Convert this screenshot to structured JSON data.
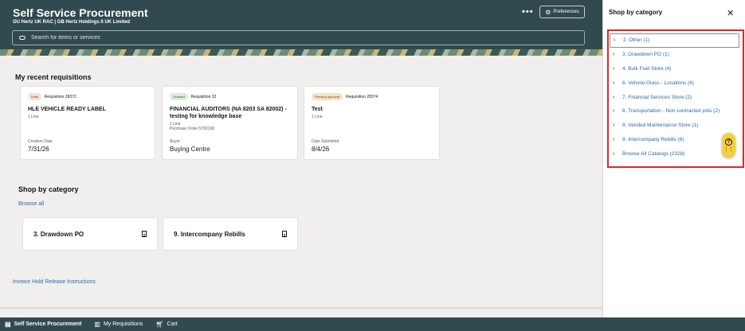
{
  "header": {
    "title": "Self Service Procurement",
    "subtitle": "OU Hertz UK RAC | GB Hertz Holdings II UK Limited",
    "more_label": "•••",
    "preferences_label": "Preferences",
    "search_placeholder": "Search for items or services"
  },
  "recent": {
    "title": "My recent requisitions",
    "cards": [
      {
        "status": "Draft",
        "requisition": "Requisition 28372",
        "title": "HLE VEHICLE READY LABEL",
        "lines": "1 Line",
        "extra": "",
        "foot_label": "Creation Date",
        "foot_value": "7/31/26"
      },
      {
        "status": "Ordered",
        "requisition": "Requisition 32",
        "title": "FINANCIAL AUDITORS (NA 8203 SA 82002) - testing for knowledge base",
        "lines": "1 Line",
        "extra": "Purchase Order 5700190",
        "foot_label": "Buyer",
        "foot_value": "Buying Centre"
      },
      {
        "status": "Pending approval",
        "requisition": "Requisition 28374",
        "title": "Test",
        "lines": "1 Line",
        "extra": "",
        "foot_label": "Date Submitted",
        "foot_value": "8/4/26"
      }
    ]
  },
  "shop": {
    "title": "Shop by category",
    "browse_all": "Browse all",
    "cards": [
      {
        "label": "3. Drawdown PO"
      },
      {
        "label": "9. Intercompany Rebills"
      }
    ]
  },
  "footer_link": "Invoice Hold Release Instructions",
  "bottom_nav": [
    {
      "label": "Self Service Procurement",
      "icon": "store-icon"
    },
    {
      "label": "My Requisitions",
      "icon": "book-icon"
    },
    {
      "label": "Cart",
      "icon": "cart-icon"
    }
  ],
  "panel": {
    "title": "Shop by category",
    "close_label": "✕",
    "items": [
      "2. Other (1)",
      "3. Drawdown PO (1)",
      "4. Bulk Fuel Store (4)",
      "6. Vehicle Glass - Locations (6)",
      "7. Financial Services Store (2)",
      "8. Transportation - Non contracted jobs (2)",
      "8. Vended Maintenance Store (1)",
      "9. Intercompany Rebills (6)",
      "Browse All Catalogs (2328)"
    ]
  },
  "colors": {
    "header_bg": "#314a4f",
    "link": "#2b6aa8",
    "highlight": "#d92a2a",
    "help_button": "#f5cf3c"
  }
}
